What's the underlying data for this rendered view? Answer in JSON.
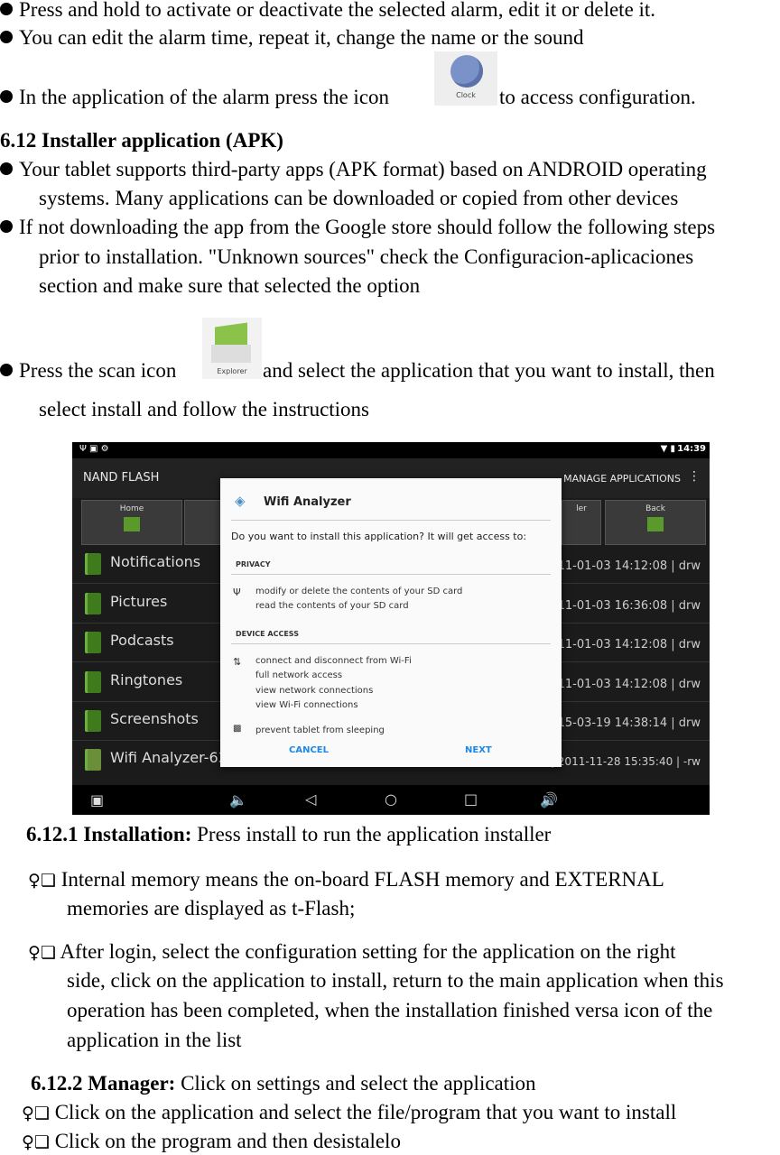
{
  "intro_bullets": [
    "Press and hold to activate or deactivate the selected alarm, edit it or delete it.",
    "You can edit the alarm time, repeat it, change the name or the sound"
  ],
  "clock_bullet": {
    "before": "In the application of the alarm press the icon",
    "icon_label": "Clock",
    "after": "to access configuration."
  },
  "section_612": {
    "heading": "6.12 Installer application (APK)",
    "bullet1": [
      "Your tablet supports third-party apps (APK format) based on ANDROID operating",
      "systems. Many applications can be downloaded or copied from other devices"
    ],
    "bullet2": [
      "If not downloading the app from the Google store should follow the following steps",
      "prior to installation. \"Unknown sources\" check the Configuracion-aplicaciones",
      "section and make sure that selected the option"
    ],
    "bullet3": {
      "before": "Press the scan icon",
      "icon_label": "Explorer",
      "after": "and select the application that you want to install, then",
      "line2": "select install and follow the instructions"
    }
  },
  "screenshot": {
    "status_time": "14:39",
    "app_title": "NAND FLASH",
    "manage_label": "MANAGE APPLICATIONS",
    "toolbar": [
      {
        "label": "Home"
      },
      {
        "label": ""
      },
      {
        "label": "ler"
      },
      {
        "label": "Back"
      }
    ],
    "rows": [
      {
        "name": "Notifications",
        "date": "2011-01-03 14:12:08 | drw"
      },
      {
        "name": "Pictures",
        "date": "2011-01-03 16:36:08 | drw"
      },
      {
        "name": "Podcasts",
        "date": "2011-01-03 14:12:08 | drw"
      },
      {
        "name": "Ringtones",
        "date": "2011-01-03 14:12:08 | drw"
      },
      {
        "name": "Screenshots",
        "date": "2015-03-19 14:38:14 | drw"
      },
      {
        "name": "Wifi Analyzer-63",
        "date": "452.25 K | 2011-11-28 15:35:40 | -rw"
      }
    ],
    "dialog": {
      "app_name": "Wifi Analyzer",
      "question": "Do you want to install this application? It will get access to:",
      "privacy_header": "PRIVACY",
      "privacy_items": [
        "modify or delete the contents of your SD card",
        "read the contents of your SD card"
      ],
      "device_header": "DEVICE ACCESS",
      "device_items": [
        "connect and disconnect from Wi-Fi",
        "full network access",
        "view network connections",
        "view Wi-Fi connections"
      ],
      "sleep_item": "prevent tablet from sleeping",
      "cancel_label": "CANCEL",
      "next_label": "NEXT"
    }
  },
  "section_6121": {
    "heading": "6.12.1 Installation:",
    "heading_rest": " Press install to run the application installer",
    "item1": [
      "Internal memory means the on-board FLASH memory and EXTERNAL",
      "memories are displayed as t-Flash;"
    ],
    "item2": [
      "After login, select the configuration setting for the application on the right",
      "side, click on the application to install, return to the main application when this",
      "operation has been completed, when the installation finished versa icon of the",
      "application in the list"
    ]
  },
  "section_6122": {
    "heading": "6.12.2 Manager:",
    "heading_rest": " Click on settings and select the application",
    "items": [
      "Click on the application and select the file/program that you want to install",
      "Click on the program and then desistalelo"
    ]
  },
  "item_marker": "♀❏"
}
